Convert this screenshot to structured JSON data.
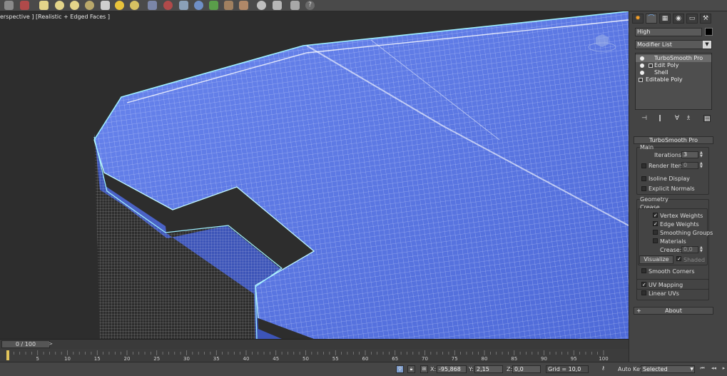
{
  "viewport": {
    "label": "erspective ] [Realistic + Edged Faces ]"
  },
  "panel": {
    "object_name": "High",
    "modifier_list": "Modifier List",
    "stack": [
      "TurboSmooth Pro",
      "Edit Poly",
      "Shell",
      "Editable Poly"
    ],
    "turbosmooth": {
      "title": "TurboSmooth Pro",
      "main_label": "Main",
      "iterations_label": "Iterations:",
      "iterations_value": "3",
      "render_iters_label": "Render Iters:",
      "render_iters_value": "0",
      "isoline_label": "Isoline Display",
      "explicit_normals_label": "Explicit Normals",
      "geometry_label": "Geometry",
      "crease_label": "Crease",
      "vertex_weights_label": "Vertex Weights",
      "edge_weights_label": "Edge Weights",
      "smoothing_groups_label": "Smoothing Groups",
      "materials_label": "Materials",
      "crease_field_label": "Crease:",
      "crease_value": "0,0",
      "visualize_label": "Visualize",
      "shaded_label": "Shaded",
      "smooth_corners_label": "Smooth Corners",
      "uv_mapping_label": "UV Mapping",
      "linear_uvs_label": "Linear UVs"
    },
    "about_title": "About"
  },
  "timeline": {
    "position": "0 / 100",
    "ticks": [
      5,
      10,
      15,
      20,
      25,
      30,
      35,
      40,
      45,
      50,
      55,
      60,
      65,
      70,
      75,
      80,
      85,
      90,
      95,
      100
    ]
  },
  "status": {
    "x_label": "X:",
    "x_value": "-95,868",
    "y_label": "Y:",
    "y_value": "2,15",
    "z_label": "Z:",
    "z_value": "0,0",
    "grid": "Grid = 10,0",
    "auto_key": "Auto Key",
    "selected": "Selected"
  },
  "colors": {
    "mesh_face": "#5a78e6",
    "wire": "#ffffff",
    "accent": "#f6a028"
  }
}
